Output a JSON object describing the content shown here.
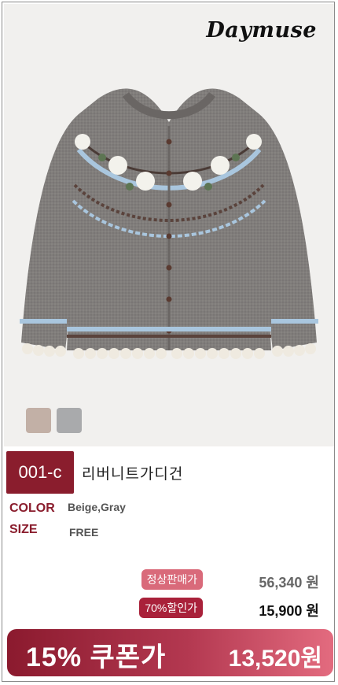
{
  "brand": "Daymuse",
  "product": {
    "code": "001-c",
    "name": "리버니트가디건",
    "image_alt": "gray fair isle knit cardigan with white flower yoke",
    "swatches": [
      {
        "name": "Beige",
        "color": "#c2b0a6"
      },
      {
        "name": "Gray",
        "color": "#a9aaac"
      }
    ],
    "color_label": "COLOR",
    "color_value": "Beige,Gray",
    "size_label": "SIZE",
    "size_value": "FREE"
  },
  "pricing": {
    "regular_label": "정상판매가",
    "regular_price": "56,340 원",
    "discount_label": "70%할인가",
    "discount_price": "15,900 원",
    "coupon_label": "15% 쿠폰가",
    "coupon_price": "13,520원"
  },
  "colors": {
    "accent": "#8a1d2d",
    "pill_regular": "#d96a7a",
    "pill_discount": "#a9213a"
  }
}
